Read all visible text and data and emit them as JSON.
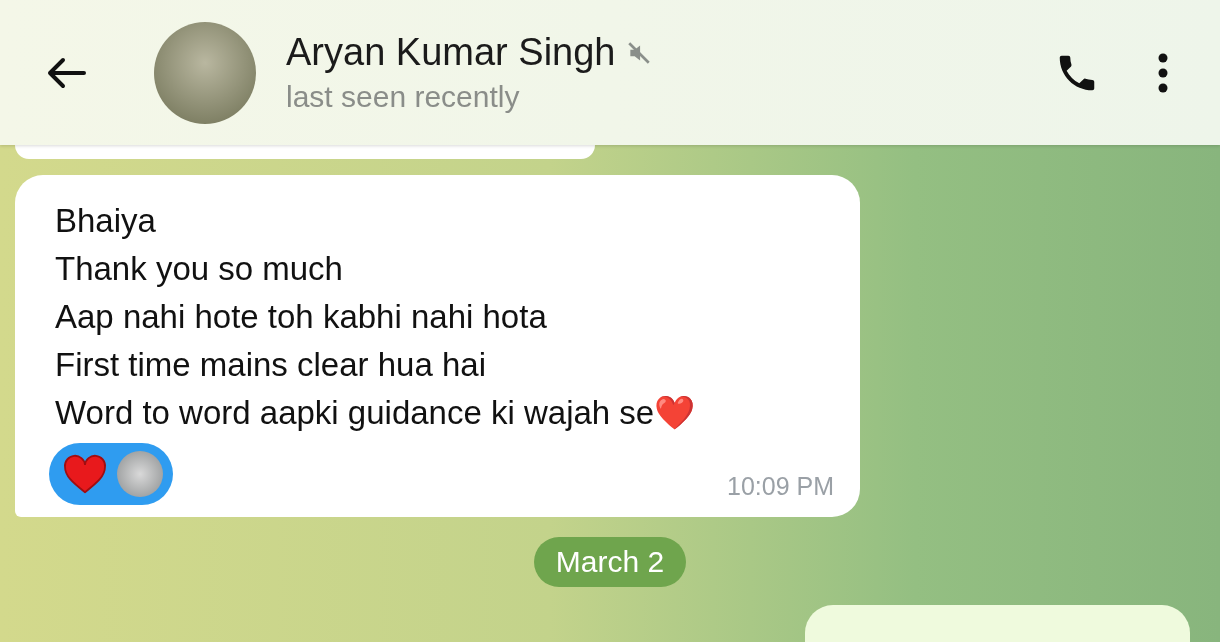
{
  "header": {
    "name": "Aryan Kumar Singh",
    "muted": true,
    "status": "last seen recently"
  },
  "messages": [
    {
      "lines": [
        "Bhaiya",
        "Thank you so much",
        "Aap nahi hote toh kabhi nahi hota",
        "First time mains clear hua hai",
        "Word to word aapki guidance ki wajah se❤️"
      ],
      "time": "10:09 PM",
      "reactions": [
        {
          "kind": "heart"
        }
      ]
    }
  ],
  "date_divider": "March 2"
}
